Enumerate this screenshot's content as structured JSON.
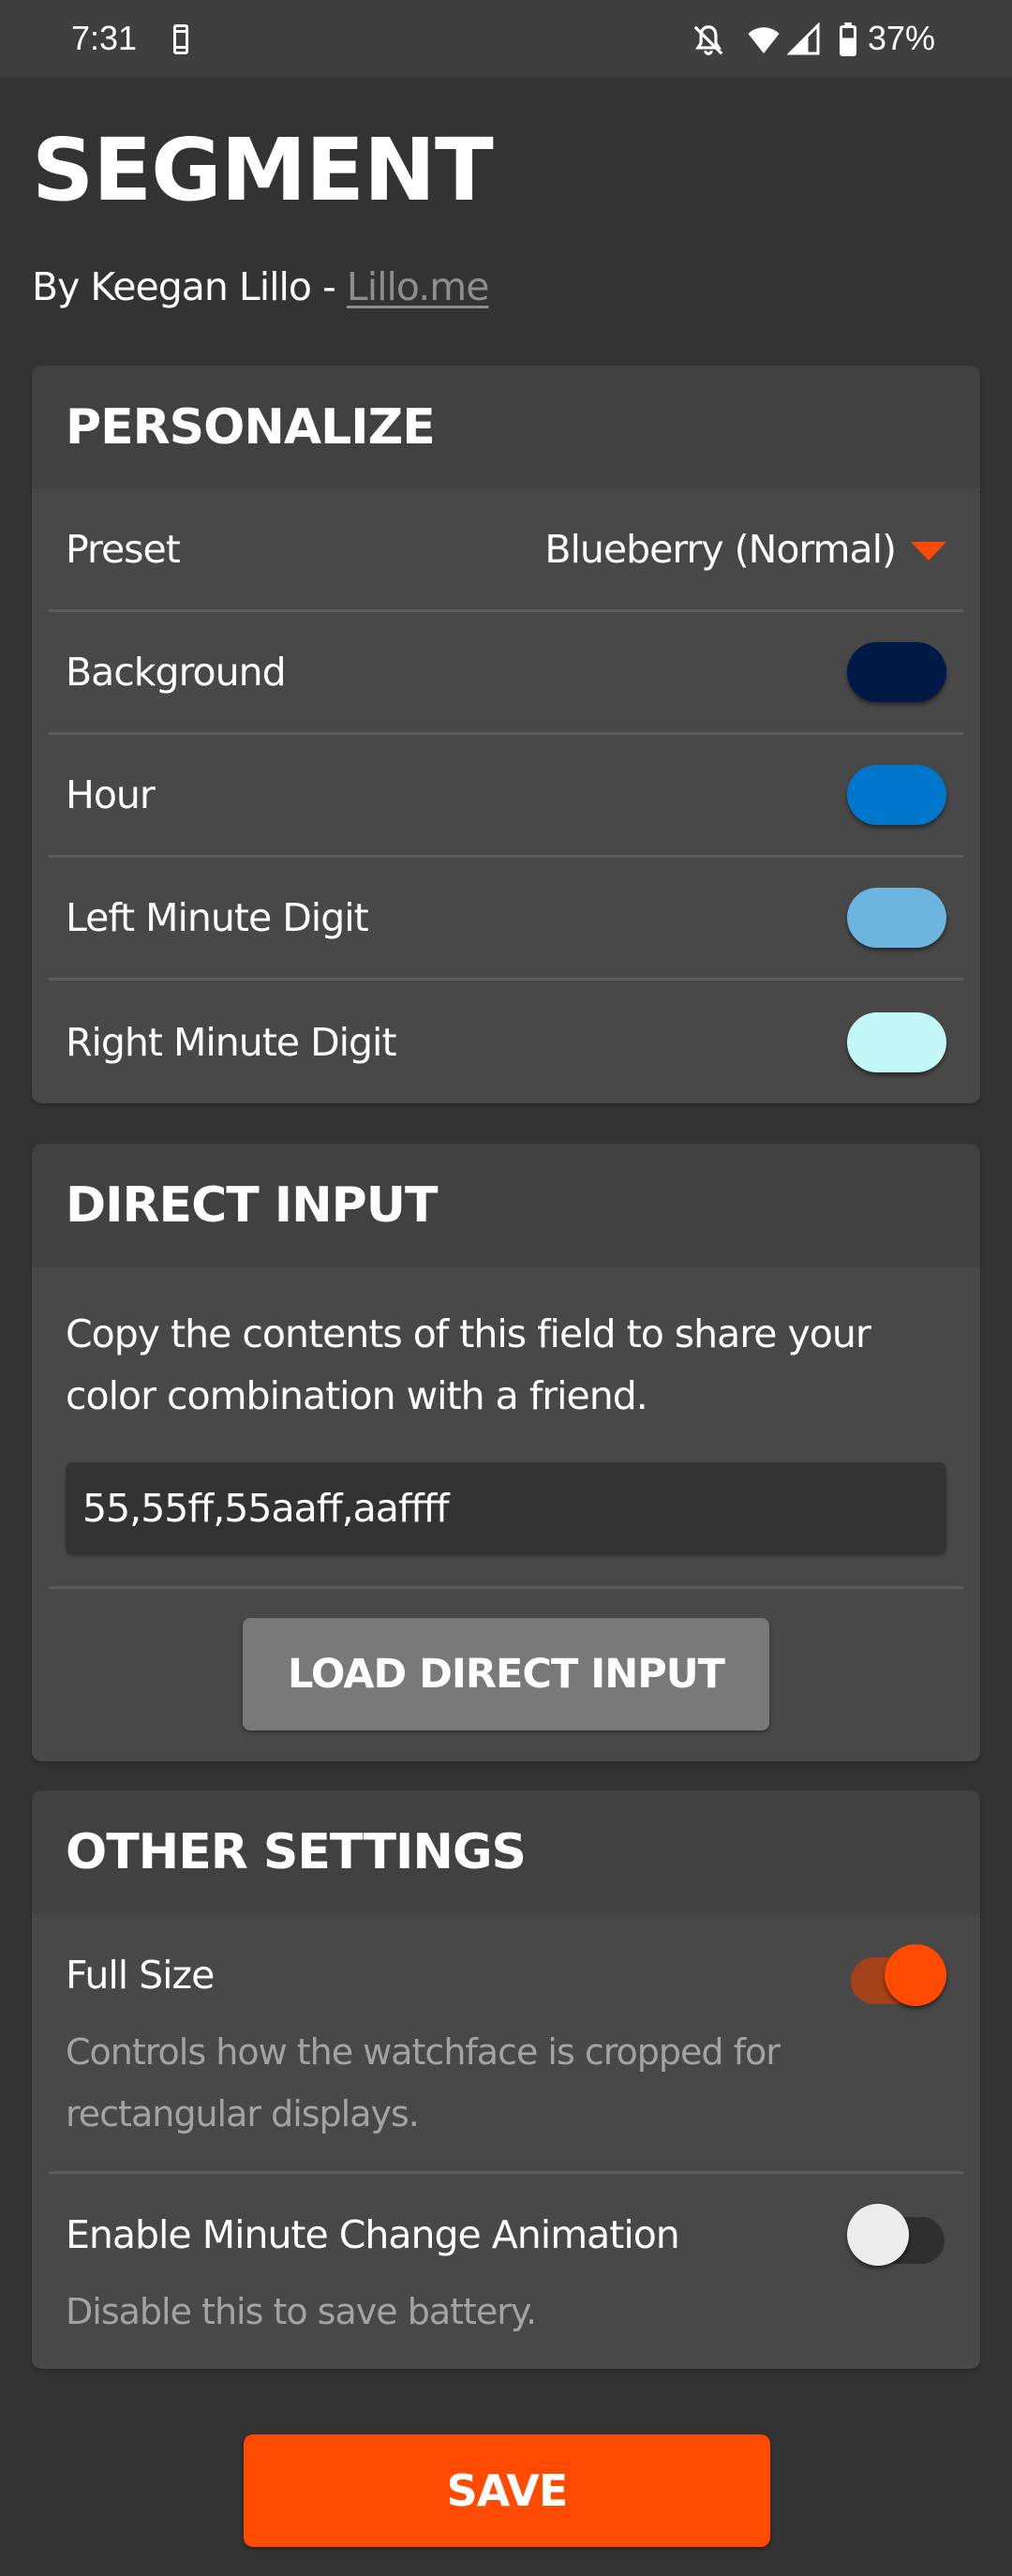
{
  "status_bar": {
    "time": "7:31",
    "battery_percent": "37%",
    "icons": [
      "phone-icon",
      "bell-off-icon",
      "wifi-icon",
      "signal-icon",
      "battery-icon"
    ]
  },
  "header": {
    "title": "SEGMENT",
    "byline_prefix": "By Keegan Lillo - ",
    "byline_link": "Lillo.me"
  },
  "personalize": {
    "title": "PERSONALIZE",
    "preset": {
      "label": "Preset",
      "value": "Blueberry (Normal)"
    },
    "colors": [
      {
        "label": "Background",
        "color": "#001a45"
      },
      {
        "label": "Hour",
        "color": "#0077cc"
      },
      {
        "label": "Left Minute Digit",
        "color": "#6bb5e0"
      },
      {
        "label": "Right Minute Digit",
        "color": "#c4f8f8"
      }
    ]
  },
  "direct_input": {
    "title": "DIRECT INPUT",
    "description": "Copy the contents of this field to share your color combination with a friend.",
    "field_value": "55,55ff,55aaff,aaffff",
    "load_button": "LOAD DIRECT INPUT"
  },
  "other_settings": {
    "title": "OTHER SETTINGS",
    "items": [
      {
        "label": "Full Size",
        "hint": "Controls how the watchface is cropped for rectangular displays.",
        "enabled": true
      },
      {
        "label": "Enable Minute Change Animation",
        "hint": "Disable this to save battery.",
        "enabled": false
      }
    ]
  },
  "save_button": "SAVE",
  "colors": {
    "accent": "#ff4a00",
    "background": "#333333",
    "card": "#484848",
    "card_header": "#414141"
  }
}
